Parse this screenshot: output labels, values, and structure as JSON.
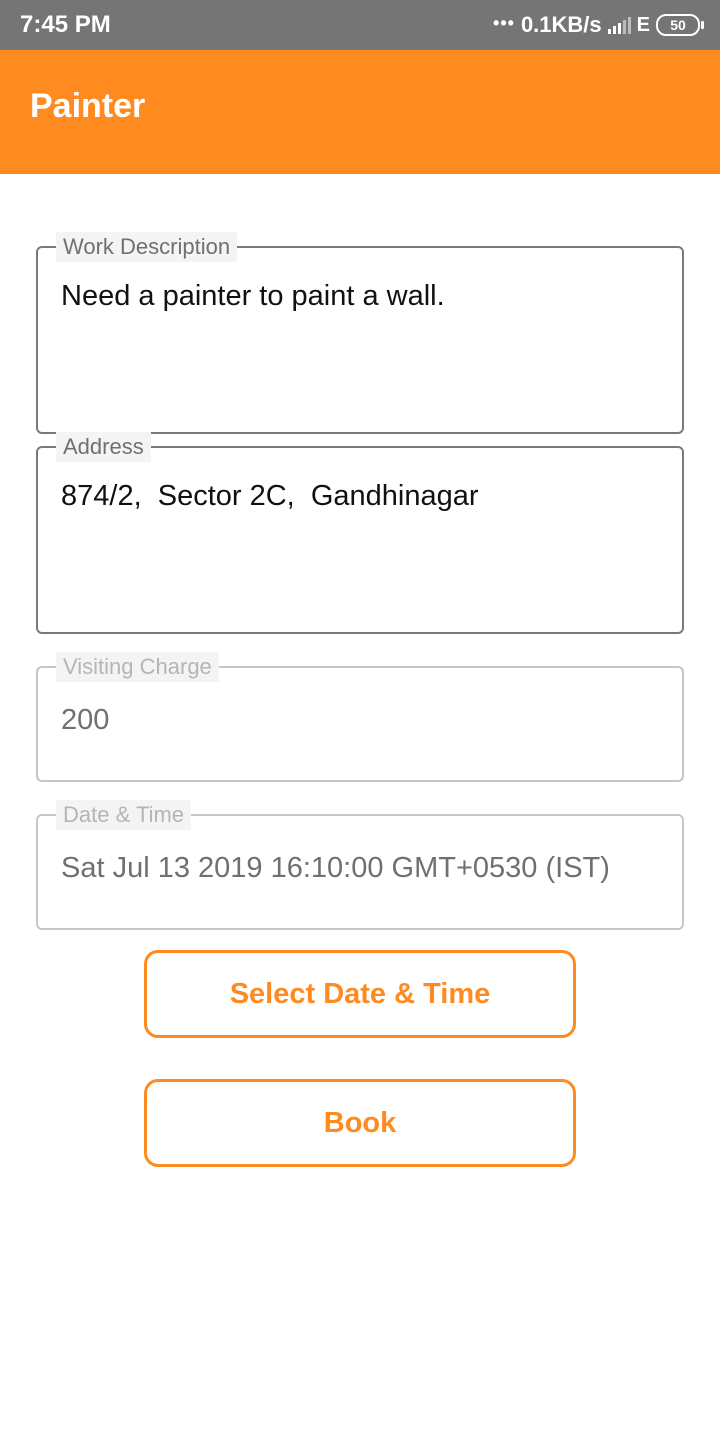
{
  "status_bar": {
    "time": "7:45 PM",
    "dots": "•••",
    "speed": "0.1KB/s",
    "network_type": "E",
    "battery": "50"
  },
  "app_bar": {
    "title": "Painter",
    "color": "#ff8a1f"
  },
  "form": {
    "work_description": {
      "label": "Work Description",
      "value": "Need a painter to paint a wall."
    },
    "address": {
      "label": "Address",
      "value": "874/2,  Sector 2C,  Gandhinagar"
    },
    "visiting_charge": {
      "label": "Visiting Charge",
      "value": "200"
    },
    "date_time": {
      "label": "Date & Time",
      "value": "Sat Jul 13 2019 16:10:00 GMT+0530 (IST)"
    }
  },
  "buttons": {
    "select_date_time": "Select Date & Time",
    "book": "Book"
  }
}
